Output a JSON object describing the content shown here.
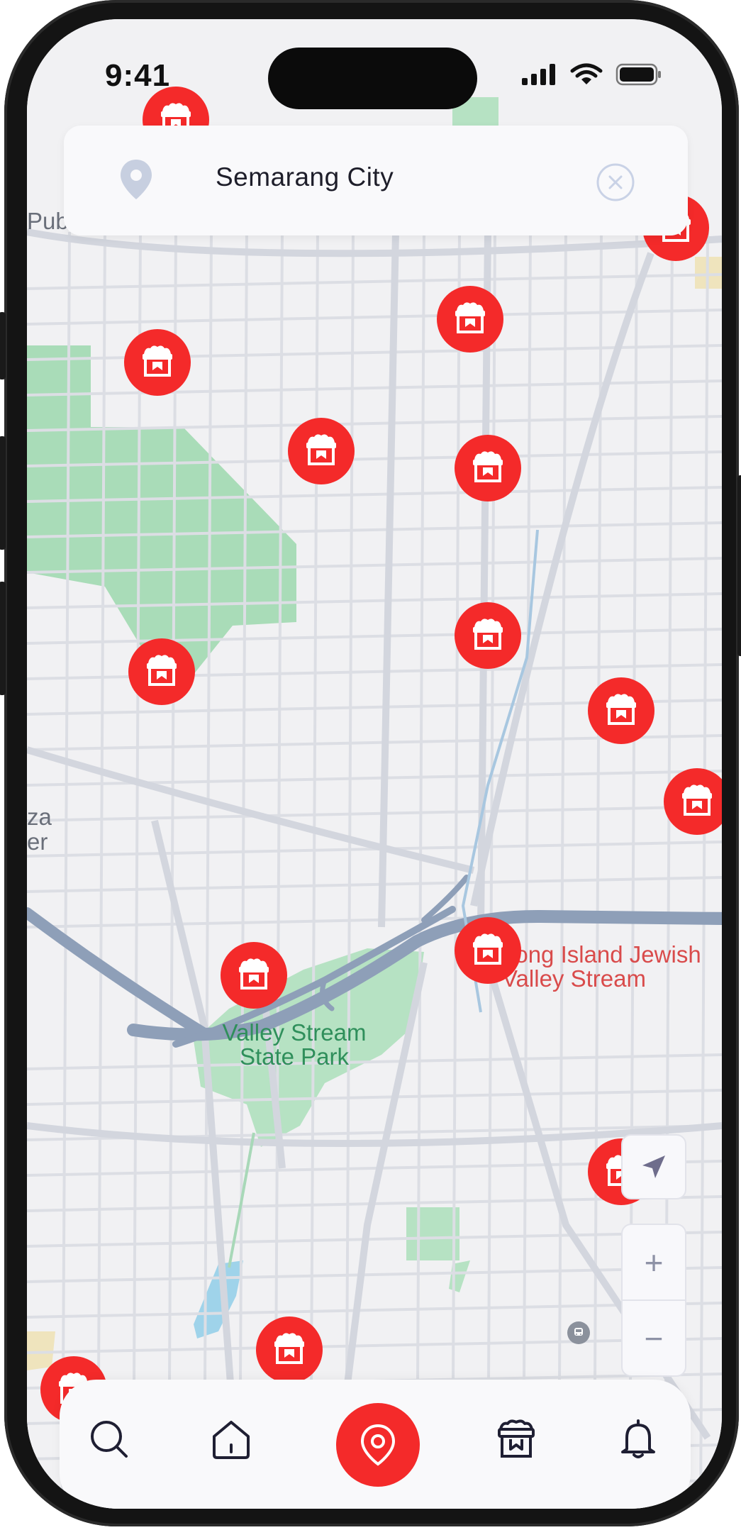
{
  "status_bar": {
    "time": "9:41"
  },
  "search": {
    "location": "Semarang City"
  },
  "map": {
    "labels": {
      "park_line1": "Valley Stream",
      "park_line2": "State Park",
      "hospital_line1": "Long Island Jewish",
      "hospital_line2": "Valley Stream",
      "edge_top": "Pub",
      "edge_left1": "za",
      "edge_left2": "er"
    },
    "marker_icon": "store-icon",
    "marker_color": "#f42a2a"
  },
  "controls": {
    "locate_icon": "navigation-arrow-icon",
    "zoom_in": "+",
    "zoom_out": "−"
  },
  "nav": {
    "items": [
      "search-icon",
      "home-icon",
      "location-pin-icon",
      "store-icon",
      "bell-icon"
    ],
    "active": "location-pin-icon",
    "accent": "#f42a2a"
  }
}
